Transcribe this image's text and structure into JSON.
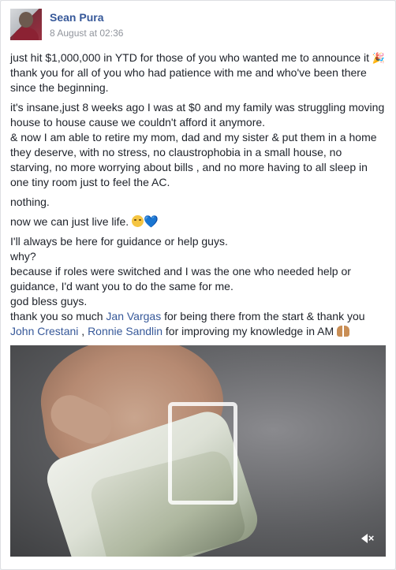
{
  "post": {
    "author": "Sean Pura",
    "timestamp": "8 August at 02:36",
    "paragraphs": {
      "p1_a": "just hit $1,000,000 in YTD for those of you who wanted me to announce it",
      "p1_b": " thank you for all of you who had patience with me and who've been there since the beginning.",
      "p2": "it's insane,just 8 weeks ago I was at $0 and my family was struggling moving house to house cause we couldn't afford it anymore.",
      "p3": "& now I am able to retire my mom, dad and my sister & put them in a home they deserve, with no stress, no claustrophobia in a small house, no starving, no more worrying about bills , and no more having to all sleep in one tiny room just to feel the AC.",
      "p4": "nothing.",
      "p5": "now we can just live life.",
      "p6_l1": "I'll always be here for guidance or help guys.",
      "p6_l2": "why?",
      "p6_l3": "because if roles were switched and I was the one who needed help or guidance, I'd want you to do the same for me.",
      "p6_l4": "god bless guys.",
      "p6_l5_a": "thank you so much ",
      "mention1": "Jan Vargas",
      "p6_l5_b": " for being there from the start & thank you ",
      "mention2": "John Crestani",
      "sep": " , ",
      "mention3": "Ronnie Sandlin",
      "p6_l5_c": " for improving my knowledge in AM "
    },
    "emoji": {
      "party": "🎉",
      "heart": "💙"
    },
    "video": {
      "mute_icon": "volume-muted-icon"
    }
  },
  "colors": {
    "link": "#365899",
    "text": "#1d2129",
    "meta": "#90949c",
    "page_bg": "#e9ebee"
  }
}
